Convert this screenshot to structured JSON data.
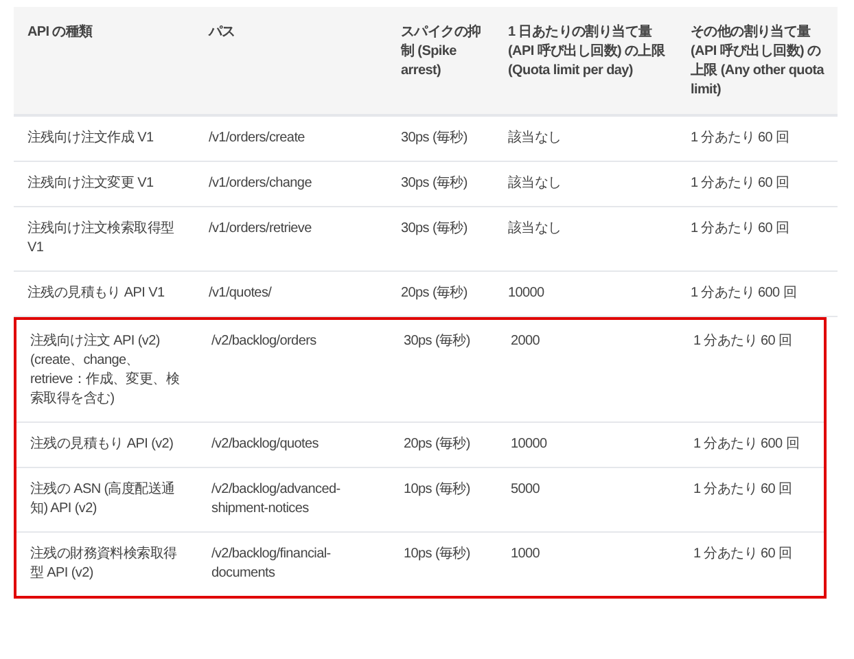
{
  "table": {
    "columns": [
      "API の種類",
      "パス",
      "スパイクの抑制 (Spike arrest)",
      "1 日あたりの割り当て量 (API 呼び出し回数) の上限 (Quota limit per day)",
      "その他の割り当て量 (API 呼び出し回数) の上限 (Any other quota limit)"
    ],
    "rows": [
      {
        "highlighted": false,
        "cells": [
          "注残向け注文作成 V1",
          "/v1/orders/create",
          "30ps (毎秒)",
          "該当なし",
          "1 分あたり 60 回"
        ]
      },
      {
        "highlighted": false,
        "cells": [
          "注残向け注文変更 V1",
          "/v1/orders/change",
          "30ps (毎秒)",
          "該当なし",
          "1 分あたり 60 回"
        ]
      },
      {
        "highlighted": false,
        "cells": [
          "注残向け注文検索取得型 V1",
          "/v1/orders/retrieve",
          "30ps (毎秒)",
          "該当なし",
          "1 分あたり 60 回"
        ]
      },
      {
        "highlighted": false,
        "cells": [
          "注残の見積もり API V1",
          "/v1/quotes/",
          "20ps (毎秒)",
          "10000",
          "1 分あたり 600 回"
        ]
      },
      {
        "highlighted": true,
        "cells": [
          "注残向け注文 API (v2) (create、change、retrieve：作成、変更、検索取得を含む)",
          "/v2/backlog/orders",
          "30ps (毎秒)",
          "2000",
          "1 分あたり 60 回"
        ]
      },
      {
        "highlighted": true,
        "cells": [
          "注残の見積もり API (v2)",
          "/v2/backlog/quotes",
          "20ps (毎秒)",
          "10000",
          "1 分あたり 600 回"
        ]
      },
      {
        "highlighted": true,
        "cells": [
          "注残の ASN (高度配送通知) API (v2)",
          "/v2/backlog/advanced-shipment-notices",
          "10ps (毎秒)",
          "5000",
          "1 分あたり 60 回"
        ]
      },
      {
        "highlighted": true,
        "cells": [
          "注残の財務資料検索取得型 API (v2)",
          "/v2/backlog/financial-documents",
          "10ps (毎秒)",
          "1000",
          "1 分あたり 60 回"
        ]
      }
    ]
  }
}
